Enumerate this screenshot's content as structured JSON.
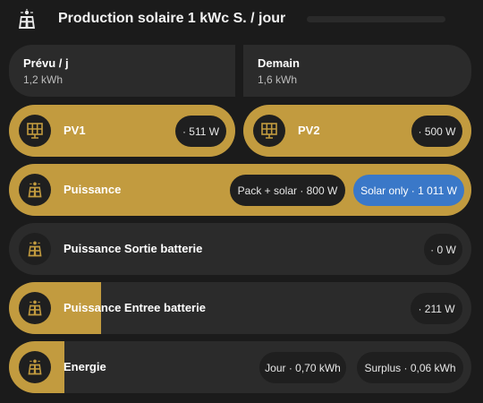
{
  "header": {
    "title": "Production solaire 1 kWc S. / jour",
    "icon": "solar-power-icon"
  },
  "forecast": {
    "today": {
      "label": "Prévu / j",
      "value": "1,2 kWh"
    },
    "tomorrow": {
      "label": "Demain",
      "value": "1,6 kWh"
    }
  },
  "pv": [
    {
      "label": "PV1",
      "value": "· 511 W",
      "icon": "solar-panel-icon"
    },
    {
      "label": "PV2",
      "value": "· 500 W",
      "icon": "solar-panel-icon"
    }
  ],
  "rows": {
    "puissance": {
      "label": "Puissance",
      "chip1": "Pack + solar · 800 W",
      "chip2": "Solar only · 1 011 W",
      "fill_fraction": 1.0
    },
    "sortie": {
      "label": "Puissance Sortie batterie",
      "chip1": "· 0 W",
      "fill_fraction": 0.0
    },
    "entree": {
      "label": "Puissance Entree batterie",
      "chip1": "· 211 W",
      "fill_fraction": 0.2
    },
    "energie": {
      "label": "Energie",
      "chip1": "Jour · 0,70 kWh",
      "chip2": "Surplus · 0,06 kWh",
      "fill_fraction": 0.12
    }
  },
  "colors": {
    "accent": "#c29b3f",
    "blue": "#3a78c8",
    "card": "#2b2b2b",
    "background": "#1b1b1b"
  }
}
